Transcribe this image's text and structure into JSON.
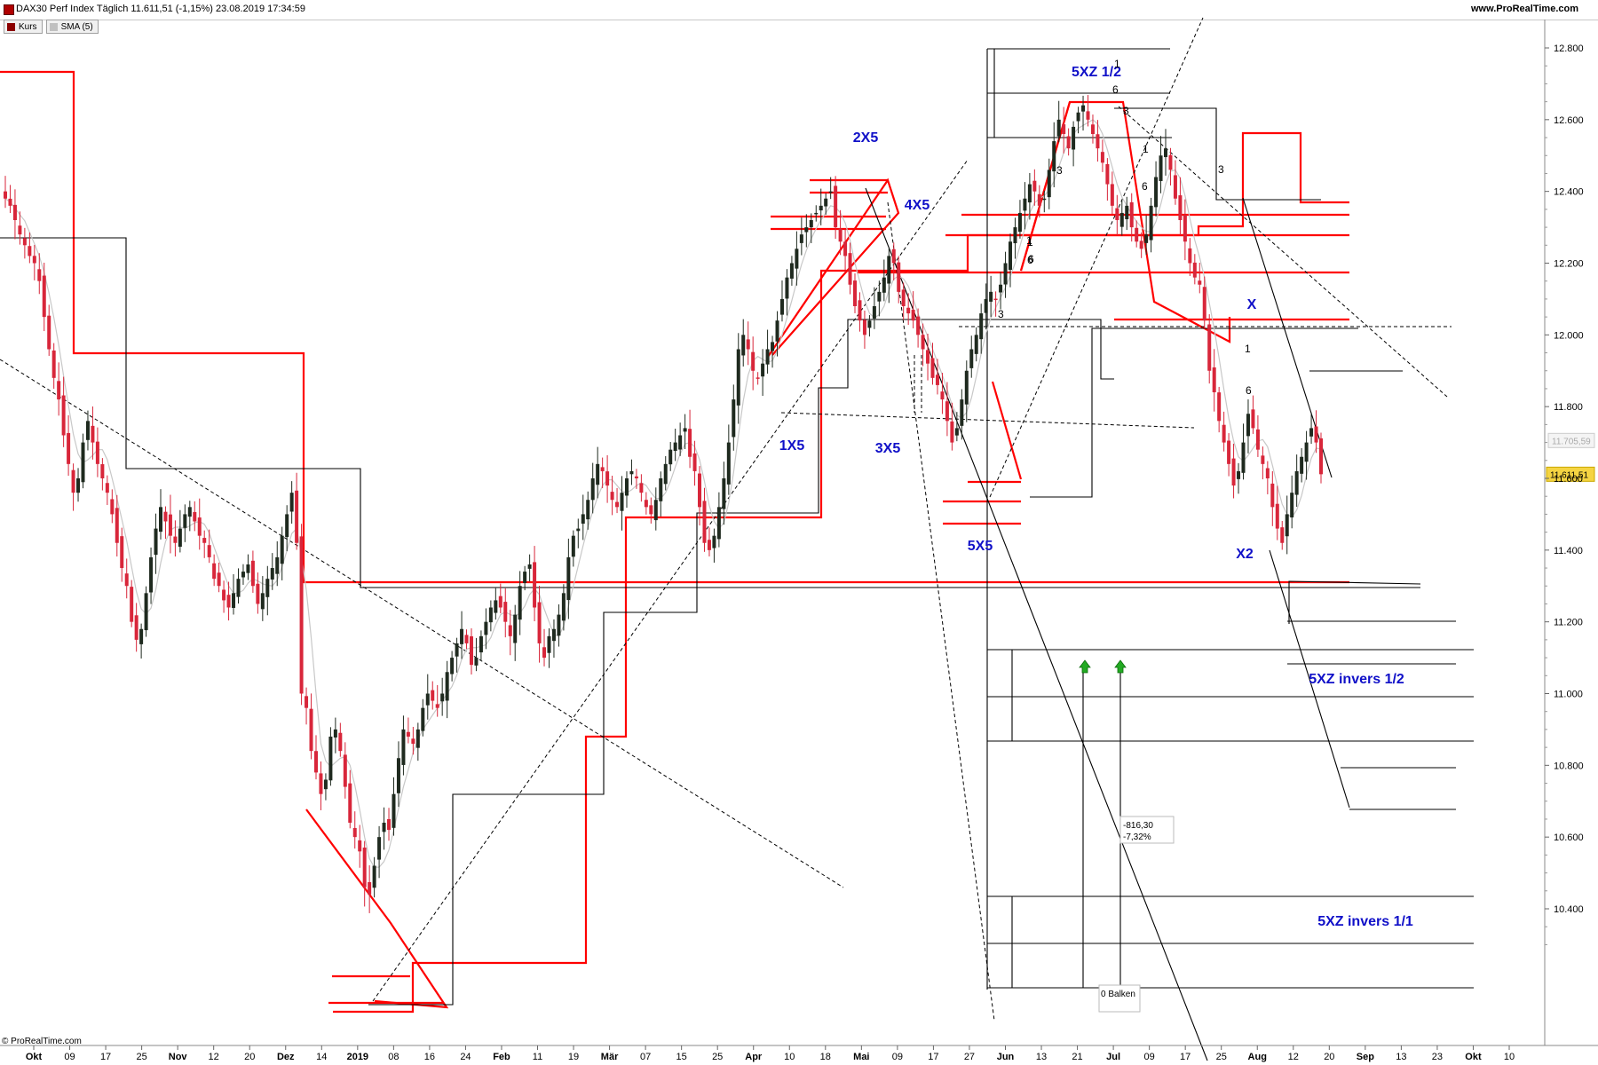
{
  "header": {
    "title": "DAX30 Perf Index Täglich 11.611,51 (-1,15%) 23.08.2019 17:34:59",
    "brand_url": "www.ProRealTime.com"
  },
  "legend": [
    {
      "label": "Kurs",
      "color": "#8b0000"
    },
    {
      "label": "SMA (5)",
      "color": "#c0c0c0"
    }
  ],
  "logo": "© ProRealTime.com",
  "colors": {
    "up": "#1f2a1f",
    "down": "#d8263a",
    "red_lines": "#ff0000",
    "sma": "#c8c8c8",
    "annotation": "#1010c8",
    "last_price_bg": "#f5d442"
  },
  "chart_data": {
    "type": "candlestick",
    "title": "DAX30 Perf Index Täglich",
    "ylim": [
      10100,
      12920
    ],
    "y_ticks": [
      10400,
      10600,
      10800,
      11000,
      11200,
      11400,
      11600,
      11800,
      12000,
      12200,
      12400,
      12600,
      12800
    ],
    "y_tick_labels": [
      "10.400",
      "10.600",
      "10.800",
      "11.000",
      "11.200",
      "11.400",
      "11.600",
      "11.800",
      "12.000",
      "12.200",
      "12.400",
      "12.600",
      "12.800"
    ],
    "x_ticks": [
      {
        "label": "Okt",
        "bold": true
      },
      {
        "label": "09"
      },
      {
        "label": "17"
      },
      {
        "label": "25"
      },
      {
        "label": "Nov",
        "bold": true
      },
      {
        "label": "12"
      },
      {
        "label": "20"
      },
      {
        "label": "Dez",
        "bold": true
      },
      {
        "label": "14"
      },
      {
        "label": "2019",
        "bold": true
      },
      {
        "label": "08"
      },
      {
        "label": "16"
      },
      {
        "label": "24"
      },
      {
        "label": "Feb",
        "bold": true
      },
      {
        "label": "11"
      },
      {
        "label": "19"
      },
      {
        "label": "Mär",
        "bold": true
      },
      {
        "label": "07"
      },
      {
        "label": "15"
      },
      {
        "label": "25"
      },
      {
        "label": "Apr",
        "bold": true
      },
      {
        "label": "10"
      },
      {
        "label": "18"
      },
      {
        "label": "Mai",
        "bold": true
      },
      {
        "label": "09"
      },
      {
        "label": "17"
      },
      {
        "label": "27"
      },
      {
        "label": "Jun",
        "bold": true
      },
      {
        "label": "13"
      },
      {
        "label": "21"
      },
      {
        "label": "Jul",
        "bold": true
      },
      {
        "label": "09"
      },
      {
        "label": "17"
      },
      {
        "label": "25"
      },
      {
        "label": "Aug",
        "bold": true
      },
      {
        "label": "12"
      },
      {
        "label": "20"
      },
      {
        "label": "Sep",
        "bold": true
      },
      {
        "label": "13"
      },
      {
        "label": "23"
      },
      {
        "label": "Okt",
        "bold": true
      },
      {
        "label": "10"
      }
    ],
    "last_price": {
      "value": 11611.51,
      "label": "11.611,51"
    },
    "prev_marker": {
      "value": 11705.59,
      "label": "11.705,59"
    },
    "closes": [
      12380,
      12360,
      12320,
      12280,
      12250,
      12220,
      12200,
      12150,
      12050,
      11960,
      11880,
      11820,
      11720,
      11640,
      11560,
      11600,
      11700,
      11760,
      11700,
      11640,
      11600,
      11560,
      11500,
      11420,
      11350,
      11300,
      11200,
      11150,
      11180,
      11280,
      11380,
      11460,
      11520,
      11480,
      11440,
      11420,
      11460,
      11500,
      11520,
      11480,
      11440,
      11420,
      11380,
      11320,
      11300,
      11260,
      11240,
      11280,
      11320,
      11340,
      11360,
      11300,
      11250,
      11280,
      11320,
      11350,
      11380,
      11440,
      11500,
      11560,
      11420,
      11000,
      10960,
      10840,
      10780,
      10720,
      10760,
      10880,
      10900,
      10840,
      10740,
      10640,
      10600,
      10560,
      10460,
      10440,
      10520,
      10600,
      10640,
      10620,
      10720,
      10820,
      10900,
      10880,
      10860,
      10900,
      10960,
      11000,
      10980,
      10960,
      11000,
      11060,
      11100,
      11140,
      11180,
      11140,
      11080,
      11100,
      11160,
      11200,
      11240,
      11260,
      11240,
      11200,
      11160,
      11220,
      11300,
      11340,
      11360,
      11240,
      11140,
      11100,
      11160,
      11180,
      11220,
      11280,
      11380,
      11440,
      11460,
      11500,
      11540,
      11600,
      11640,
      11620,
      11580,
      11540,
      11520,
      11560,
      11600,
      11620,
      11600,
      11560,
      11520,
      11500,
      11540,
      11600,
      11640,
      11680,
      11700,
      11720,
      11740,
      11660,
      11620,
      11520,
      11420,
      11400,
      11440,
      11520,
      11600,
      11700,
      11820,
      11960,
      12000,
      11960,
      11900,
      11880,
      11920,
      11960,
      11980,
      12040,
      12100,
      12160,
      12200,
      12240,
      12280,
      12300,
      12320,
      12340,
      12360,
      12380,
      12400,
      12300,
      12260,
      12220,
      12140,
      12080,
      12040,
      12000,
      12040,
      12080,
      12120,
      12160,
      12220,
      12200,
      12120,
      12080,
      12060,
      12040,
      12000,
      11960,
      11920,
      11880,
      11860,
      11820,
      11760,
      11700,
      11740,
      11820,
      11900,
      11960,
      12000,
      12060,
      12100,
      12120,
      12100,
      12140,
      12200,
      12260,
      12300,
      12340,
      12380,
      12420,
      12400,
      12360,
      12380,
      12460,
      12540,
      12600,
      12560,
      12520,
      12580,
      12620,
      12640,
      12600,
      12560,
      12520,
      12480,
      12420,
      12360,
      12320,
      12340,
      12360,
      12300,
      12260,
      12240,
      12280,
      12360,
      12440,
      12500,
      12520,
      12460,
      12380,
      12320,
      12260,
      12200,
      12160,
      12140,
      12040,
      11900,
      11840,
      11760,
      11700,
      11640,
      11580,
      11620,
      11700,
      11780,
      11740,
      11680,
      11640,
      11600,
      11520,
      11460,
      11420,
      11500,
      11560,
      11620,
      11660,
      11700,
      11740,
      11700,
      11611.51
    ]
  },
  "annotations": {
    "wave_labels": [
      "2X5",
      "4X5",
      "1X5",
      "3X5",
      "5X5",
      "5XZ 1/2",
      "X",
      "X2",
      "5XZ invers 1/2",
      "5XZ invers 1/1"
    ],
    "count_labels": [
      "1",
      "6",
      "3",
      "3",
      "3",
      "1",
      "6",
      "3",
      "1",
      "6",
      "1",
      "6",
      "1",
      "6"
    ],
    "measure_value": "-816,30",
    "measure_pct": "-7,32%",
    "bars_label": "0 Balken"
  }
}
